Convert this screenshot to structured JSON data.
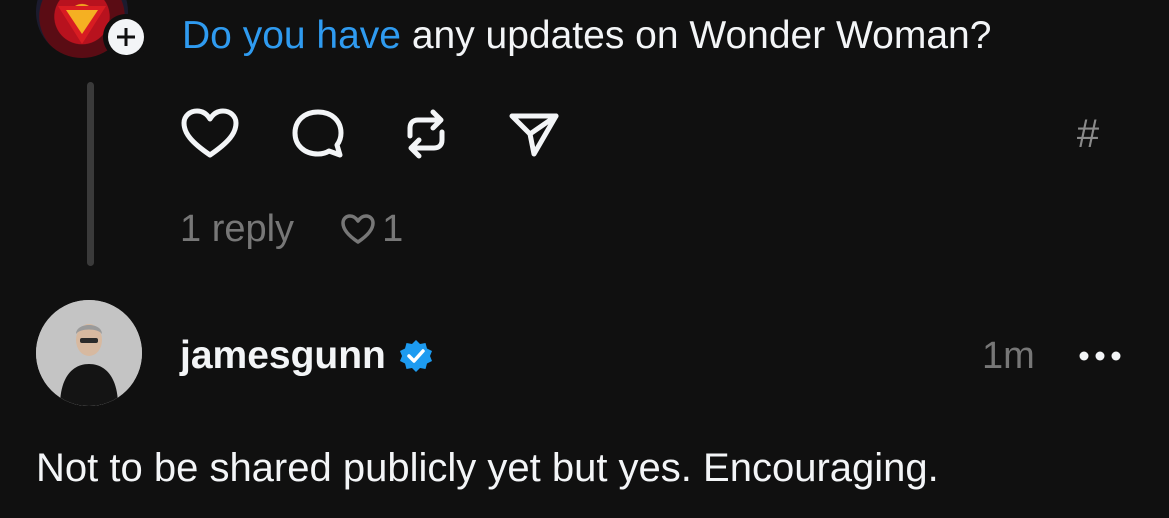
{
  "top_post": {
    "avatar_icon": "superhero-emblem-avatar",
    "follow_icon": "plus-icon",
    "text_link": "Do you have",
    "text_rest": " any updates on Wonder Woman?",
    "link_color": "#2f9bf0",
    "actions": {
      "like_icon": "heart-icon",
      "comment_icon": "comment-icon",
      "repost_icon": "repost-icon",
      "share_icon": "send-icon",
      "hash_label": "#"
    },
    "reply_count": "1 reply",
    "like_count": "1"
  },
  "reply": {
    "avatar_icon": "profile-photo-avatar",
    "username": "jamesgunn",
    "verified_icon": "verified-badge-icon",
    "verified_color": "#1d9bf0",
    "time": "1m",
    "more_icon": "more-options-icon",
    "text": "Not to be shared publicly yet but yes. Encouraging."
  }
}
